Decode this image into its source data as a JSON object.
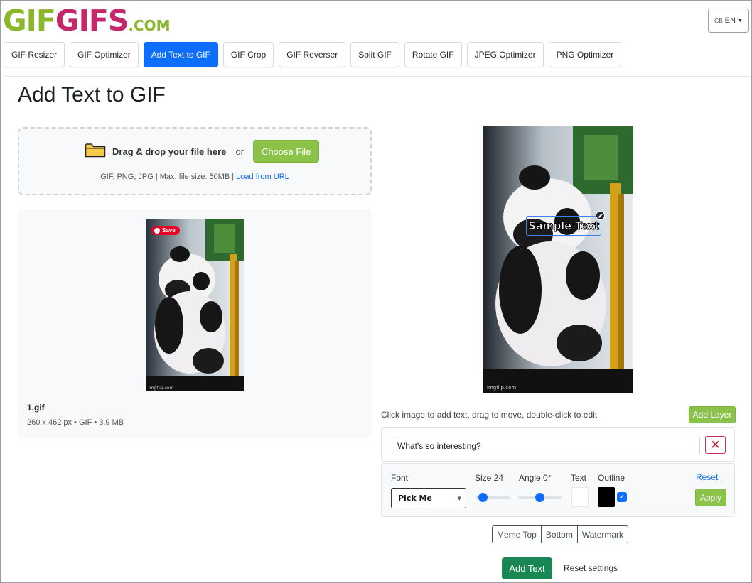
{
  "brand": {
    "part1": "GIF",
    "part2": "GIFS",
    "suffix": ".COM"
  },
  "language": {
    "flag": "GB",
    "label": "EN"
  },
  "tabs": [
    {
      "label": "GIF Resizer"
    },
    {
      "label": "GIF Optimizer"
    },
    {
      "label": "Add Text to GIF",
      "active": true
    },
    {
      "label": "GIF Crop"
    },
    {
      "label": "GIF Reverser"
    },
    {
      "label": "Split GIF"
    },
    {
      "label": "Rotate GIF"
    },
    {
      "label": "JPEG Optimizer"
    },
    {
      "label": "PNG Optimizer"
    }
  ],
  "page": {
    "title": "Add Text to GIF"
  },
  "upload": {
    "drop_text": "Drag & drop your file here",
    "or_text": "or",
    "choose_label": "Choose File",
    "info_text": "GIF, PNG, JPG | Max. file size: 50MB |",
    "url_link": "Load from URL"
  },
  "file": {
    "save_badge": "Save",
    "thumb_credit": "imgflip.com",
    "name": "1.gif",
    "meta": "260 x 462 px • GIF • 3.9 MB"
  },
  "editor": {
    "overlay_text": "Sample Text",
    "preview_credit": "imgflip.com",
    "hint": "Click image to add text, drag to move, double-click to edit",
    "add_layer_label": "Add Layer",
    "layer_text": "What's so interesting?",
    "delete_label": "✕",
    "font_label": "Font",
    "font_value": "Pick Me",
    "size_label": "Size 24",
    "size_value": 24,
    "angle_label": "Angle 0°",
    "angle_value": 0,
    "text_color_label": "Text",
    "text_color": "#ffffff",
    "outline_label": "Outline",
    "outline_color": "#000000",
    "outline_enabled": true,
    "reset_label": "Reset",
    "apply_label": "Apply"
  },
  "presets": [
    {
      "label": "Meme Top"
    },
    {
      "label": "Bottom"
    },
    {
      "label": "Watermark"
    }
  ],
  "actions": {
    "add_text_label": "Add Text",
    "reset_settings_label": "Reset settings"
  },
  "colors": {
    "accent": "#0d6efd",
    "brand_green": "#8bc34a",
    "brand_pink": "#c4286b",
    "success": "#198754",
    "danger": "#c1121f"
  }
}
